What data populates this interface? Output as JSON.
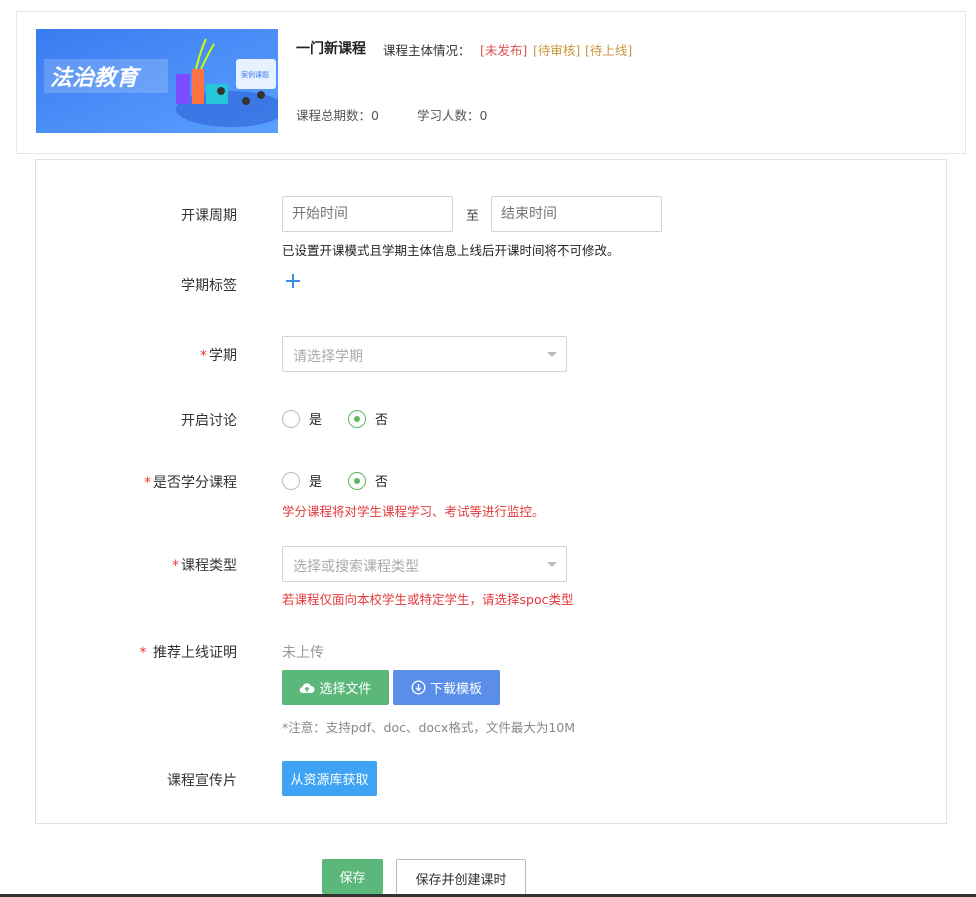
{
  "course": {
    "thumbnail_text": "法治教育",
    "thumbnail_small_text": "案例课题",
    "title": "一门新课程",
    "status_label": "课程主体情况：",
    "statuses": [
      "[未发布]",
      "[待审核]",
      "[待上线]"
    ],
    "total_periods": "课程总期数：0",
    "learners": "学习人数：0"
  },
  "form": {
    "period": {
      "label": "开课周期",
      "start_placeholder": "开始时间",
      "to": "至",
      "end_placeholder": "结束时间",
      "hint": "已设置开课模式且学期主体信息上线后开课时间将不可修改。"
    },
    "tag": {
      "label": "学期标签",
      "add_icon": "plus-icon"
    },
    "semester": {
      "required_mark": "*",
      "label": "学期",
      "placeholder": "请选择学期"
    },
    "discussion": {
      "label": "开启讨论",
      "options": [
        "是",
        "否"
      ],
      "selected": "否"
    },
    "credit": {
      "required_mark": "*",
      "label": "是否学分课程",
      "options": [
        "是",
        "否"
      ],
      "selected": "否",
      "hint": "学分课程将对学生课程学习、考试等进行监控。"
    },
    "course_type": {
      "required_mark": "*",
      "label": "课程类型",
      "placeholder": "选择或搜索课程类型",
      "hint": "若课程仅面向本校学生或特定学生，请选择spoc类型"
    },
    "proof": {
      "required_mark": "* ",
      "label": "推荐上线证明",
      "status": "未上传",
      "choose_file": "选择文件",
      "download_template": "下载模板",
      "note": "*注意：支持pdf、doc、docx格式，文件最大为10M"
    },
    "promo": {
      "label": "课程宣传片",
      "button": "从资源库获取"
    }
  },
  "actions": {
    "save": "保存",
    "save_create": "保存并创建课时"
  },
  "colors": {
    "accent_green": "#5cb87a",
    "accent_blue": "#5a8ee8",
    "sky_blue": "#3fa3f5",
    "required_red": "#e4393c",
    "status_red": "#d9534f",
    "status_orange": "#c8963e"
  }
}
